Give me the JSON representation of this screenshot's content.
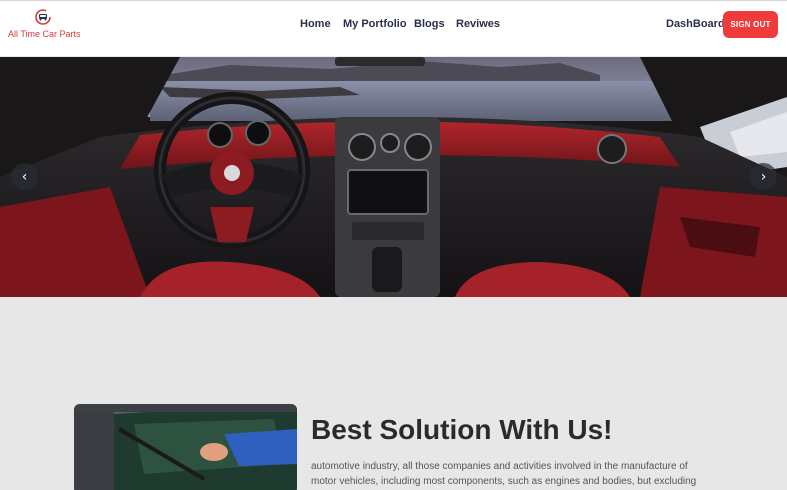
{
  "brand": {
    "name": "All Time Car Parts",
    "icon": "car-badge-icon",
    "color": "#d93a3a"
  },
  "nav": {
    "home": "Home",
    "portfolio": "My Portfolio",
    "blogs": "Blogs",
    "reviews": "Reviwes"
  },
  "account": {
    "dashboard": "DashBoard",
    "signout": "SIGN OUT",
    "signout_color": "#ef3b3b"
  },
  "hero": {
    "image": "red car interior dashboard with ocean view",
    "prev_icon": "chevron-left-icon",
    "next_icon": "chevron-right-icon",
    "prev_glyph": "‹",
    "next_glyph": "›"
  },
  "solution": {
    "title": "Best Solution With Us!",
    "text": "automotive industry, all those companies and activities involved in the manufacture of motor vehicles, including most components, such as engines and bodies, but excluding tires, batteries,"
  }
}
